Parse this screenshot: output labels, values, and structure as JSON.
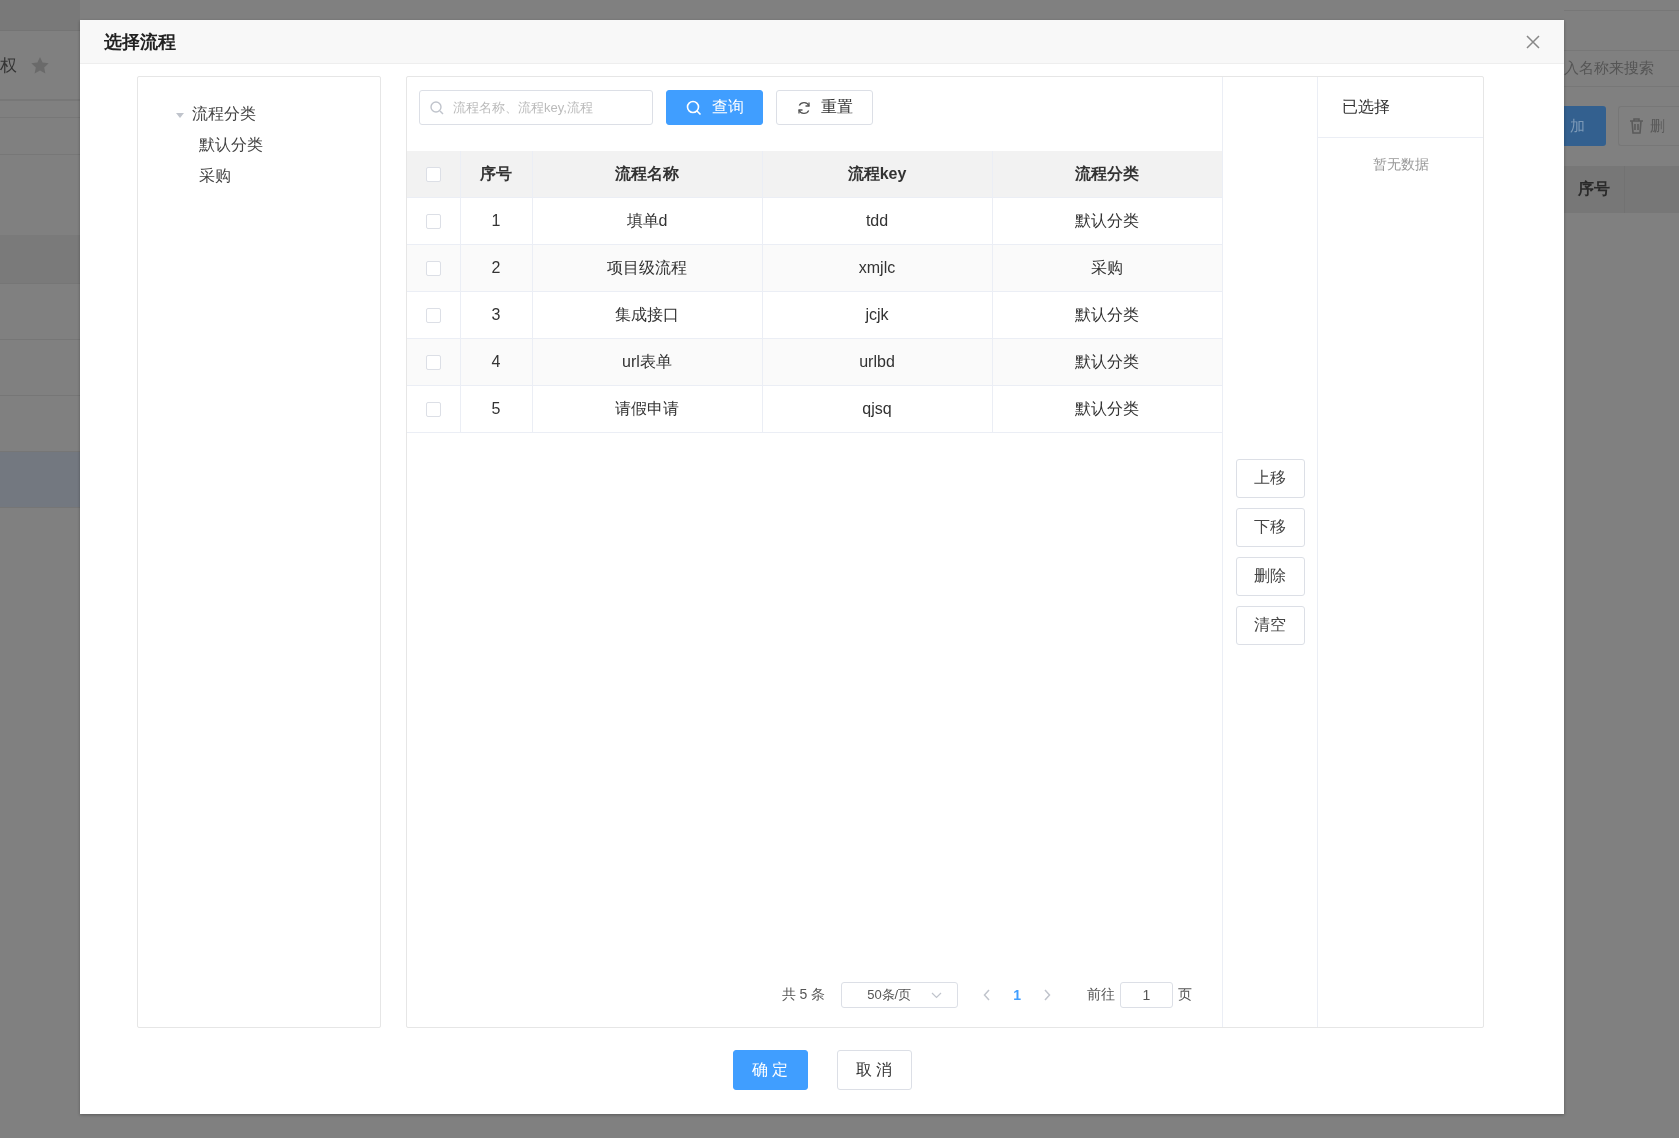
{
  "background": {
    "left": {
      "title": "权"
    },
    "right": {
      "search_placeholder": "入名称来搜索",
      "add_button": "加",
      "delete_button": "删",
      "column_header": "序号"
    }
  },
  "dialog": {
    "title": "选择流程",
    "tree": [
      {
        "label": "流程分类",
        "expanded": true,
        "children": [
          {
            "label": "默认分类"
          },
          {
            "label": "采购"
          }
        ]
      }
    ],
    "search": {
      "placeholder": "流程名称、流程key,流程"
    },
    "query_button": "查询",
    "reset_button": "重置",
    "table": {
      "select_all": {
        "checked": false
      },
      "columns": [
        "序号",
        "流程名称",
        "流程key",
        "流程分类"
      ],
      "rows": [
        {
          "checked": false,
          "cells": [
            "1",
            "填单d",
            "tdd",
            "默认分类"
          ]
        },
        {
          "checked": false,
          "cells": [
            "2",
            "项目级流程",
            "xmjlc",
            "采购"
          ]
        },
        {
          "checked": false,
          "cells": [
            "3",
            "集成接口",
            "jcjk",
            "默认分类"
          ]
        },
        {
          "checked": false,
          "cells": [
            "4",
            "url表单",
            "urlbd",
            "默认分类"
          ]
        },
        {
          "checked": false,
          "cells": [
            "5",
            "请假申请",
            "qjsq",
            "默认分类"
          ]
        }
      ]
    },
    "pagination": {
      "total": "共 5 条",
      "page_size": "50条/页",
      "current_page": "1",
      "goto_label": "前往",
      "goto_value": "1",
      "page_suffix": "页"
    },
    "move_buttons": [
      "上移",
      "下移",
      "删除",
      "清空"
    ],
    "selected_panel": {
      "title": "已选择",
      "empty_text": "暂无数据"
    },
    "footer_buttons": [
      {
        "kind": "primary",
        "label": "确 定"
      },
      {
        "kind": "default",
        "label": "取 消"
      }
    ]
  }
}
